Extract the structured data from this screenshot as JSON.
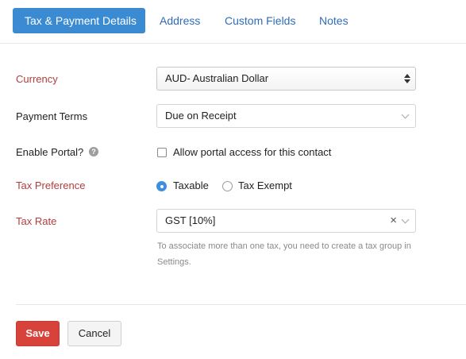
{
  "tabs": [
    {
      "label": "Tax & Payment Details",
      "active": true
    },
    {
      "label": "Address",
      "active": false
    },
    {
      "label": "Custom Fields",
      "active": false
    },
    {
      "label": "Notes",
      "active": false
    }
  ],
  "form": {
    "currency": {
      "label": "Currency",
      "value": "AUD- Australian Dollar"
    },
    "payment_terms": {
      "label": "Payment Terms",
      "value": "Due on Receipt"
    },
    "enable_portal": {
      "label": "Enable Portal?",
      "help_icon": "?",
      "checkbox_label": "Allow portal access for this contact",
      "checked": false
    },
    "tax_preference": {
      "label": "Tax Preference",
      "options": [
        {
          "label": "Taxable",
          "selected": true
        },
        {
          "label": "Tax Exempt",
          "selected": false
        }
      ]
    },
    "tax_rate": {
      "label": "Tax Rate",
      "value": "GST [10%]",
      "clear_symbol": "×",
      "hint": "To associate more than one tax, you need to create a tax group in Settings."
    }
  },
  "footer": {
    "save_label": "Save",
    "cancel_label": "Cancel"
  },
  "colors": {
    "accent": "#3b8bd3",
    "link": "#2f6cba",
    "required_label": "#b33d3d",
    "save_button": "#d7423b"
  },
  "icons": [
    "help-icon",
    "updown-arrows-icon",
    "chevron-down-icon",
    "clear-icon"
  ]
}
